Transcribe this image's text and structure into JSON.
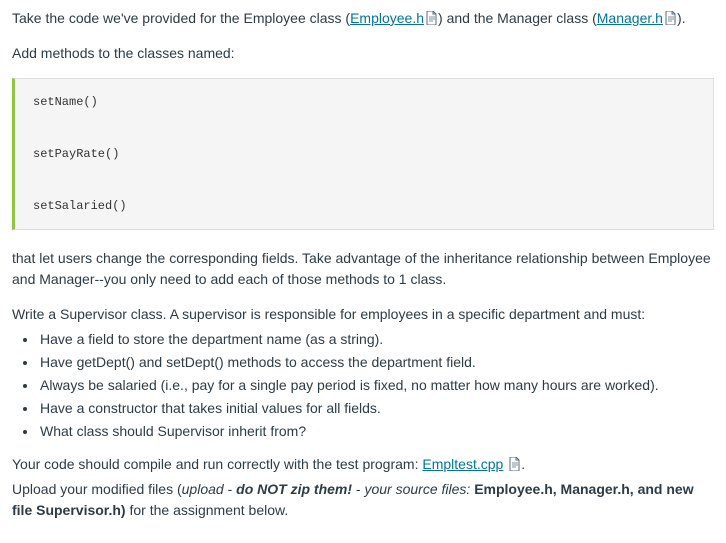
{
  "intro": {
    "part1": "Take the code we've provided for the Employee class (",
    "link1": "Employee.h",
    "part2": ") and the Manager class (",
    "link2": "Manager.h",
    "part3": ")."
  },
  "addMethods": "Add methods to the classes named:",
  "code": {
    "line1": "setName()",
    "line2": "setPayRate()",
    "line3": "setSalaried()"
  },
  "afterCode": "that let users change the corresponding fields. Take advantage of the inheritance relationship between Employee and Manager--you only need to add each of those methods to 1 class.",
  "supervisorIntro": "Write a Supervisor class. A supervisor is responsible for employees in a specific department and must:",
  "bullets": [
    "Have a field to store the department name (as a string).",
    "Have getDept() and setDept() methods to access the department field.",
    "Always be salaried (i.e., pay for a single pay period is fixed, no matter how many hours are worked).",
    "Have a constructor that takes initial values for all fields.",
    "What class should Supervisor inherit from?"
  ],
  "compile": {
    "part1": "Your code should compile and run correctly with the test program: ",
    "link": "Empltest.cpp",
    "part2": "."
  },
  "upload": {
    "part1": "Upload your modified files (",
    "italic1": "upload",
    "part2": " - ",
    "bolditalic": "do NOT zip them!",
    "part3": " - ",
    "italic2": "your source files:",
    "part4": "  ",
    "bold": "Employee.h, Manager.h, and new file Supervisor.h)",
    "part5": " for the assignment below."
  }
}
